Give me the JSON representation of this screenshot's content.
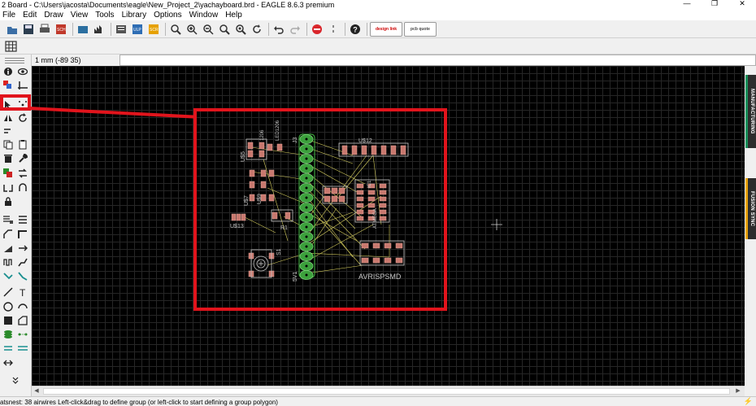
{
  "window": {
    "title": "2 Board - C:\\Users\\jacosta\\Documents\\eagle\\New_Project_2\\yachayboard.brd - EAGLE 8.6.3 premium",
    "minimize_glyph": "—",
    "maximize_glyph": "❐",
    "close_glyph": "✕"
  },
  "menu": [
    "File",
    "Edit",
    "Draw",
    "View",
    "Tools",
    "Library",
    "Options",
    "Window",
    "Help"
  ],
  "toolbar": {
    "design_link_label": "design link",
    "pcb_quote_label": "PCB quote",
    "icons": [
      "open-icon",
      "save-icon",
      "print-icon",
      "cam-icon",
      "board-icon",
      "schematic-icon",
      "script-icon",
      "ulp-icon",
      "zoom-fit-icon",
      "zoom-in-icon",
      "zoom-out-icon",
      "zoom-area-icon",
      "zoom-select-icon",
      "redraw-icon",
      "undo-icon",
      "redo-icon",
      "stop-icon",
      "go-icon",
      "help-icon"
    ]
  },
  "coordinate_readout": "1 mm (-89 35)",
  "command_line": {
    "value": "",
    "placeholder": ""
  },
  "side_tabs": {
    "manufacturing": "MANUFACTURING",
    "fusion_sync": "FUSION SYNC"
  },
  "status": {
    "text": "atsnest: 38 airwires Left-click&drag to define group (or left-click to start defining a group polygon)"
  },
  "pcb_labels": {
    "u12": "U$12",
    "u5": "U$5",
    "u7": "U$7",
    "u9": "U$9",
    "u13": "U$13",
    "r1": "R1",
    "s1": "S1",
    "j3": "J3",
    "v1": "5V1",
    "avrisp": "AVRISPSMD",
    "ic1": "IC1",
    "c1206a": "1206",
    "c1206b": "LED1206",
    "atmega": "ATMEGA"
  },
  "colors": {
    "highlight": "#e1141c",
    "canvas": "#000000",
    "pad_green": "#3ca03c",
    "smd_pad": "#c8786e",
    "airwire": "#d8d060",
    "silk": "#c8c8c8"
  }
}
